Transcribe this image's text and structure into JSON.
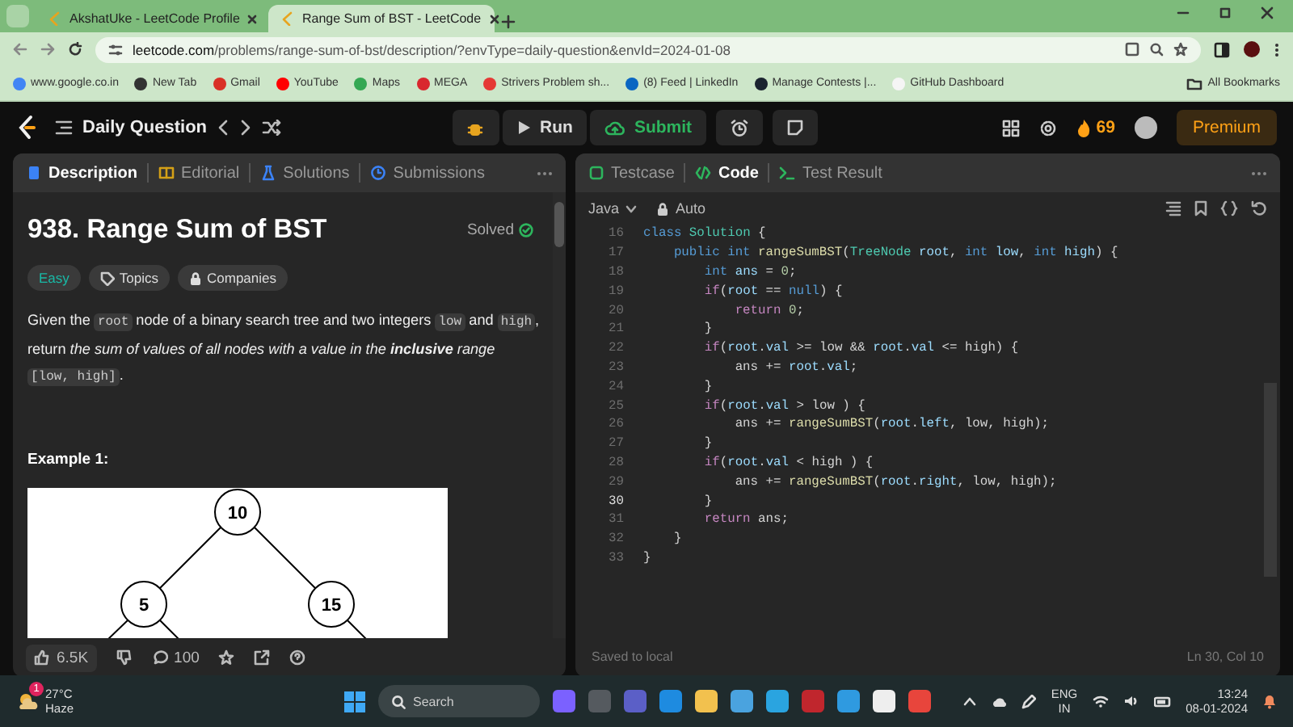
{
  "browser": {
    "tabs": [
      {
        "title": "AkshatUke - LeetCode Profile",
        "selected": false
      },
      {
        "title": "Range Sum of BST - LeetCode",
        "selected": true
      }
    ],
    "url": {
      "host": "leetcode.com",
      "path": "/problems/range-sum-of-bst/description/?envType=daily-question&envId=2024-01-08"
    },
    "bookmarks": [
      {
        "label": "www.google.co.in",
        "color": "#4285f4"
      },
      {
        "label": "New Tab",
        "color": "#333333"
      },
      {
        "label": "Gmail",
        "color": "#d93025"
      },
      {
        "label": "YouTube",
        "color": "#ff0000"
      },
      {
        "label": "Maps",
        "color": "#34a853"
      },
      {
        "label": "MEGA",
        "color": "#d9272e"
      },
      {
        "label": "Strivers Problem sh...",
        "color": "#e53935"
      },
      {
        "label": "(8) Feed | LinkedIn",
        "color": "#0a66c2"
      },
      {
        "label": "Manage Contests |...",
        "color": "#1b2430"
      },
      {
        "label": "GitHub Dashboard",
        "color": "#f5f5f5"
      }
    ],
    "all_bookmarks": "All Bookmarks"
  },
  "header": {
    "title": "Daily Question",
    "run": "Run",
    "submit": "Submit",
    "streak": "69",
    "premium": "Premium"
  },
  "left_panel": {
    "tabs": [
      {
        "label": "Description",
        "selected": true
      },
      {
        "label": "Editorial",
        "selected": false
      },
      {
        "label": "Solutions",
        "selected": false
      },
      {
        "label": "Submissions",
        "selected": false
      }
    ],
    "title": "938. Range Sum of BST",
    "status": "Solved",
    "tags": [
      {
        "kind": "difficulty",
        "label": "Easy"
      },
      {
        "kind": "topics",
        "label": "Topics"
      },
      {
        "kind": "companies",
        "label": "Companies"
      }
    ],
    "description": [
      {
        "kind": "text",
        "text": "Given the "
      },
      {
        "kind": "code",
        "text": "root"
      },
      {
        "kind": "text",
        "text": " node of a binary search tree and two integers "
      },
      {
        "kind": "code",
        "text": "low"
      },
      {
        "kind": "text",
        "text": " and "
      },
      {
        "kind": "code",
        "text": "high"
      },
      {
        "kind": "text",
        "text": ", return "
      },
      {
        "kind": "italic",
        "text": "the sum of values of all nodes with a value in the "
      },
      {
        "kind": "bolditalic",
        "text": "inclusive"
      },
      {
        "kind": "italic",
        "text": " range "
      },
      {
        "kind": "code",
        "text": "[low, high]"
      },
      {
        "kind": "text",
        "text": "."
      }
    ],
    "example_title": "Example 1:",
    "tree_nodes": [
      "10",
      "5",
      "15"
    ],
    "likes": "6.5K",
    "comments": "100"
  },
  "right_panel": {
    "tabs": [
      {
        "label": "Testcase",
        "selected": false
      },
      {
        "label": "Code",
        "selected": true
      },
      {
        "label": "Test Result",
        "selected": false
      }
    ],
    "language": "Java",
    "mode": "Auto",
    "code": [
      {
        "number": "16",
        "current": false,
        "tokens": [
          {
            "kind": "kw",
            "text": "class"
          },
          {
            "kind": "type",
            "text": " Solution"
          },
          {
            "kind": "plain",
            "text": " {"
          }
        ]
      },
      {
        "number": "17",
        "current": false,
        "tokens": [
          {
            "kind": "kw",
            "text": "    public int"
          },
          {
            "kind": "fn",
            "text": " rangeSumBST"
          },
          {
            "kind": "plain",
            "text": "("
          },
          {
            "kind": "type",
            "text": "TreeNode"
          },
          {
            "kind": "var",
            "text": " root"
          },
          {
            "kind": "plain",
            "text": ", "
          },
          {
            "kind": "kw",
            "text": "int"
          },
          {
            "kind": "var",
            "text": " low"
          },
          {
            "kind": "plain",
            "text": ", "
          },
          {
            "kind": "kw",
            "text": "int"
          },
          {
            "kind": "var",
            "text": " high"
          },
          {
            "kind": "plain",
            "text": ") {"
          }
        ]
      },
      {
        "number": "18",
        "current": false,
        "tokens": [
          {
            "kind": "kw",
            "text": "        int"
          },
          {
            "kind": "var",
            "text": " ans"
          },
          {
            "kind": "plain",
            "text": " = "
          },
          {
            "kind": "num",
            "text": "0"
          },
          {
            "kind": "plain",
            "text": ";"
          }
        ]
      },
      {
        "number": "19",
        "current": false,
        "tokens": [
          {
            "kind": "ctl",
            "text": "        if"
          },
          {
            "kind": "plain",
            "text": "("
          },
          {
            "kind": "var",
            "text": "root"
          },
          {
            "kind": "plain",
            "text": " == "
          },
          {
            "kind": "kw",
            "text": "null"
          },
          {
            "kind": "plain",
            "text": ") {"
          }
        ]
      },
      {
        "number": "20",
        "current": false,
        "tokens": [
          {
            "kind": "ctl",
            "text": "            return"
          },
          {
            "kind": "num",
            "text": " 0"
          },
          {
            "kind": "plain",
            "text": ";"
          }
        ]
      },
      {
        "number": "21",
        "current": false,
        "tokens": [
          {
            "kind": "plain",
            "text": "        }"
          }
        ]
      },
      {
        "number": "22",
        "current": false,
        "tokens": [
          {
            "kind": "ctl",
            "text": "        if"
          },
          {
            "kind": "plain",
            "text": "("
          },
          {
            "kind": "var",
            "text": "root"
          },
          {
            "kind": "plain",
            "text": "."
          },
          {
            "kind": "var",
            "text": "val"
          },
          {
            "kind": "plain",
            "text": " >= low && "
          },
          {
            "kind": "var",
            "text": "root"
          },
          {
            "kind": "plain",
            "text": "."
          },
          {
            "kind": "var",
            "text": "val"
          },
          {
            "kind": "plain",
            "text": " <= high) {"
          }
        ]
      },
      {
        "number": "23",
        "current": false,
        "tokens": [
          {
            "kind": "plain",
            "text": "            ans += "
          },
          {
            "kind": "var",
            "text": "root"
          },
          {
            "kind": "plain",
            "text": "."
          },
          {
            "kind": "var",
            "text": "val"
          },
          {
            "kind": "plain",
            "text": ";"
          }
        ]
      },
      {
        "number": "24",
        "current": false,
        "tokens": [
          {
            "kind": "plain",
            "text": "        }"
          }
        ]
      },
      {
        "number": "25",
        "current": false,
        "tokens": [
          {
            "kind": "ctl",
            "text": "        if"
          },
          {
            "kind": "plain",
            "text": "("
          },
          {
            "kind": "var",
            "text": "root"
          },
          {
            "kind": "plain",
            "text": "."
          },
          {
            "kind": "var",
            "text": "val"
          },
          {
            "kind": "plain",
            "text": " > low ) {"
          }
        ]
      },
      {
        "number": "26",
        "current": false,
        "tokens": [
          {
            "kind": "plain",
            "text": "            ans += "
          },
          {
            "kind": "fn",
            "text": "rangeSumBST"
          },
          {
            "kind": "plain",
            "text": "("
          },
          {
            "kind": "var",
            "text": "root"
          },
          {
            "kind": "plain",
            "text": "."
          },
          {
            "kind": "var",
            "text": "left"
          },
          {
            "kind": "plain",
            "text": ", low, high);"
          }
        ]
      },
      {
        "number": "27",
        "current": false,
        "tokens": [
          {
            "kind": "plain",
            "text": "        }"
          }
        ]
      },
      {
        "number": "28",
        "current": false,
        "tokens": [
          {
            "kind": "ctl",
            "text": "        if"
          },
          {
            "kind": "plain",
            "text": "("
          },
          {
            "kind": "var",
            "text": "root"
          },
          {
            "kind": "plain",
            "text": "."
          },
          {
            "kind": "var",
            "text": "val"
          },
          {
            "kind": "plain",
            "text": " < high ) {"
          }
        ]
      },
      {
        "number": "29",
        "current": false,
        "tokens": [
          {
            "kind": "plain",
            "text": "            ans += "
          },
          {
            "kind": "fn",
            "text": "rangeSumBST"
          },
          {
            "kind": "plain",
            "text": "("
          },
          {
            "kind": "var",
            "text": "root"
          },
          {
            "kind": "plain",
            "text": "."
          },
          {
            "kind": "var",
            "text": "right"
          },
          {
            "kind": "plain",
            "text": ", low, high);"
          }
        ]
      },
      {
        "number": "30",
        "current": true,
        "tokens": [
          {
            "kind": "plain",
            "text": "        }"
          }
        ]
      },
      {
        "number": "31",
        "current": false,
        "tokens": [
          {
            "kind": "ctl",
            "text": "        return"
          },
          {
            "kind": "plain",
            "text": " ans;"
          }
        ]
      },
      {
        "number": "32",
        "current": false,
        "tokens": [
          {
            "kind": "plain",
            "text": "    }"
          }
        ]
      },
      {
        "number": "33",
        "current": false,
        "tokens": [
          {
            "kind": "plain",
            "text": "}"
          }
        ]
      }
    ],
    "saved": "Saved to local",
    "cursor": "Ln 30, Col 10"
  },
  "taskbar": {
    "weather": {
      "temp": "27°C",
      "condition": "Haze",
      "badge": "1"
    },
    "search": {
      "placeholder": "Search"
    },
    "language": {
      "top": "ENG",
      "bottom": "IN"
    },
    "time": "13:24",
    "date": "08-01-2024"
  }
}
